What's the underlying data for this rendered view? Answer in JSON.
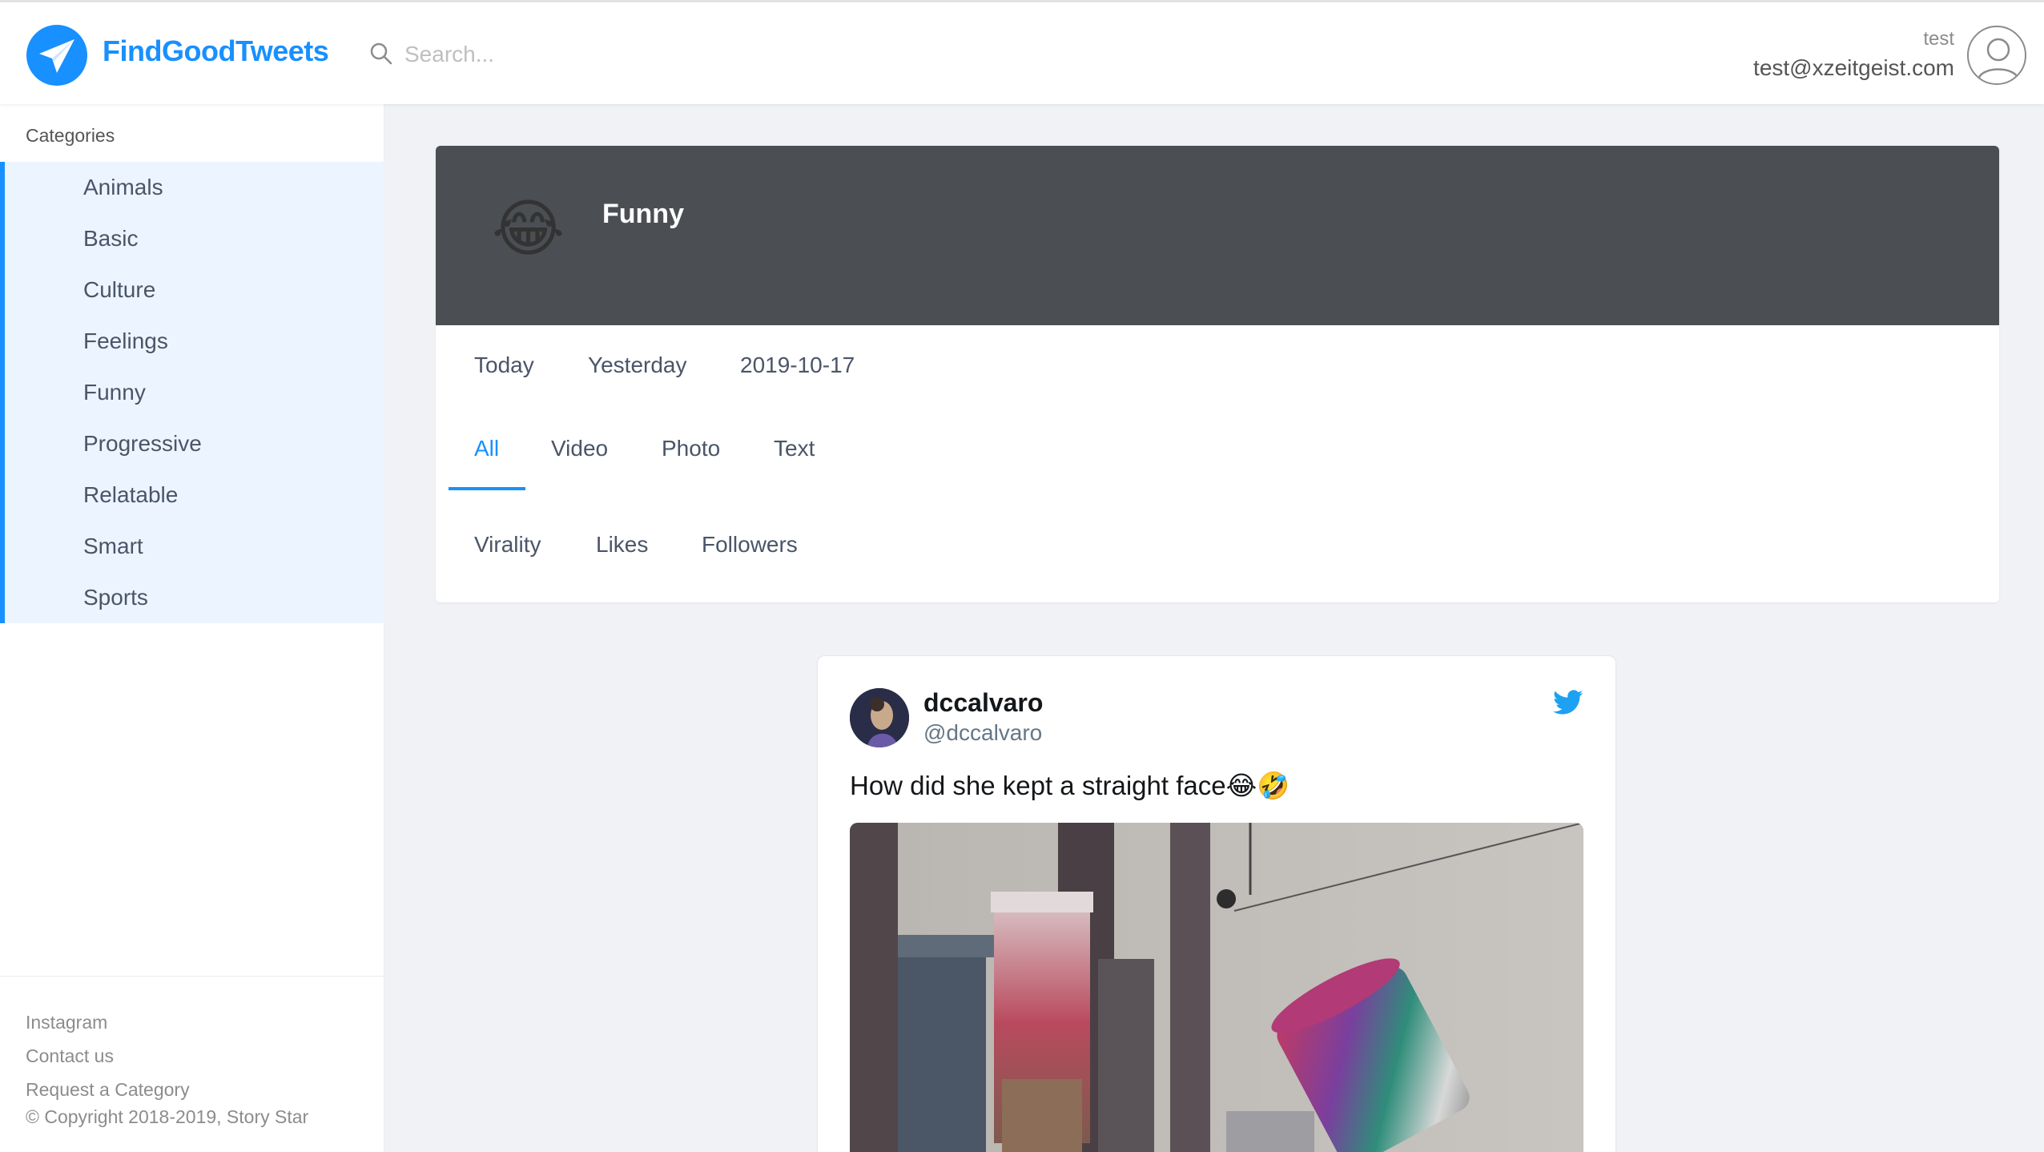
{
  "header": {
    "brand": "FindGoodTweets",
    "search_placeholder": "Search...",
    "user_name": "test",
    "user_email": "test@xzeitgeist.com"
  },
  "sidebar": {
    "title": "Categories",
    "items": [
      {
        "label": "Animals"
      },
      {
        "label": "Basic"
      },
      {
        "label": "Culture"
      },
      {
        "label": "Feelings"
      },
      {
        "label": "Funny"
      },
      {
        "label": "Progressive"
      },
      {
        "label": "Relatable"
      },
      {
        "label": "Smart"
      },
      {
        "label": "Sports"
      }
    ],
    "footer": {
      "instagram": "Instagram",
      "contact": "Contact us",
      "request": "Request a Category",
      "copyright": "© Copyright 2018-2019, Story Star"
    }
  },
  "category": {
    "emoji": "😂",
    "title": "Funny",
    "date_tabs": [
      "Today",
      "Yesterday",
      "2019-10-17"
    ],
    "type_tabs": [
      "All",
      "Video",
      "Photo",
      "Text"
    ],
    "active_type_tab": "All",
    "sort_tabs": [
      "Virality",
      "Likes",
      "Followers"
    ]
  },
  "tweet": {
    "name": "dccalvaro",
    "handle": "@dccalvaro",
    "text": "How did she kept a straight face😂🤣"
  },
  "colors": {
    "accent": "#1890ff",
    "banner": "#4b4f54",
    "sidebar_highlight": "#ecf5ff",
    "twitter": "#1da1f2"
  },
  "icons": [
    "paper-plane-icon",
    "search-icon",
    "user-avatar-icon",
    "twitter-bird-icon"
  ]
}
